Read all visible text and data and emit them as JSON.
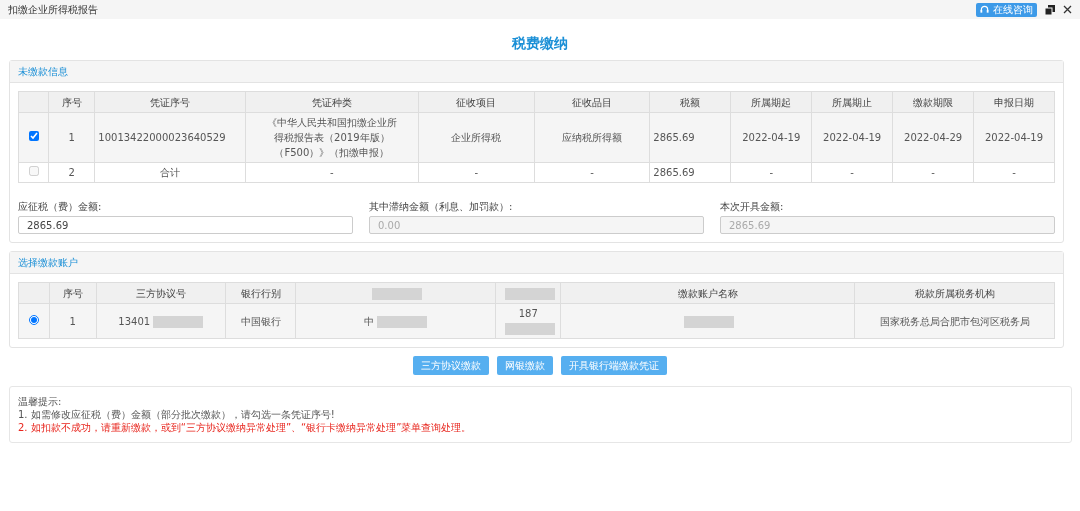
{
  "window": {
    "title": "扣缴企业所得税报告",
    "help_button": "在线咨询"
  },
  "heading": "税费缴纳",
  "unpaid": {
    "title": "未缴款信息",
    "columns": [
      "序号",
      "凭证序号",
      "凭证种类",
      "征收项目",
      "征收品目",
      "税额",
      "所属期起",
      "所属期止",
      "缴款期限",
      "申报日期"
    ],
    "rows": [
      {
        "checked": true,
        "disabled": false,
        "cells": [
          "1",
          "10013422000023640529",
          "《中华人民共和国扣缴企业所得税报告表（2019年版）（F500）》（扣缴申报）",
          "企业所得税",
          "应纳税所得额",
          "2865.69",
          "2022-04-19",
          "2022-04-19",
          "2022-04-29",
          "2022-04-19"
        ]
      },
      {
        "checked": false,
        "disabled": true,
        "cells": [
          "2",
          "合计",
          "-",
          "-",
          "-",
          "2865.69",
          "-",
          "-",
          "-",
          "-"
        ]
      }
    ],
    "fields": [
      {
        "label": "应征税（费）金额:",
        "value": "2865.69",
        "disabled": false
      },
      {
        "label": "其中滞纳金额（利息、加罚款）:",
        "value": "0.00",
        "disabled": true
      },
      {
        "label": "本次开具金额:",
        "value": "2865.69",
        "disabled": true
      }
    ]
  },
  "accounts": {
    "title": "选择缴款账户",
    "columns": [
      {
        "label": "序号",
        "redacted": false
      },
      {
        "label": "三方协议号",
        "redacted": false
      },
      {
        "label": "银行行别",
        "redacted": false
      },
      {
        "redacted": true
      },
      {
        "redacted": true
      },
      {
        "label": "缴款账户名称",
        "redacted": false
      },
      {
        "label": "税款所属税务机构",
        "redacted": false
      }
    ],
    "rows": [
      {
        "selected": true,
        "cells": [
          {
            "text": "1",
            "redacted": false
          },
          {
            "text": "13401",
            "redacted": true
          },
          {
            "text": "中国银行",
            "redacted": false
          },
          {
            "text": "中",
            "redacted": true
          },
          {
            "text": "187",
            "redacted": true
          },
          {
            "redacted": true
          },
          {
            "text": "国家税务总局合肥市包河区税务局",
            "redacted": false
          }
        ]
      }
    ]
  },
  "buttons": [
    "三方协议缴款",
    "网银缴款",
    "开具银行端缴款凭证"
  ],
  "notice": {
    "title": "温馨提示:",
    "lines": [
      {
        "kind": "normal",
        "text": "1. 如需修改应征税（费）金额（部分批次缴款），请勾选一条凭证序号!"
      },
      {
        "kind": "warning",
        "text": "2. 如扣款不成功，请重新缴款，或到“三方协议缴纳异常处理”、“银行卡缴纳异常处理”菜单查询处理。"
      }
    ]
  }
}
